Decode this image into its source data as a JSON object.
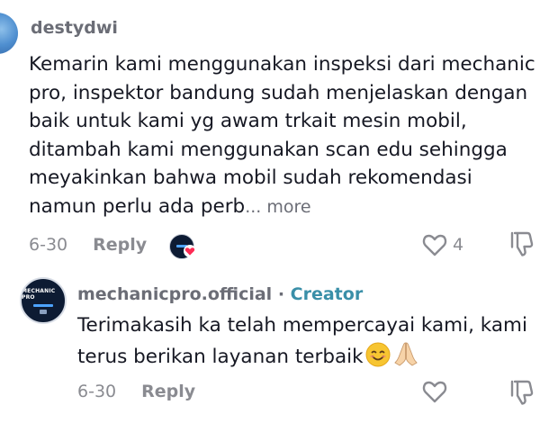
{
  "comments": [
    {
      "username": "destydwi",
      "text": "Kemarin kami menggunakan inspeksi dari mechanic pro, inspektor bandung sudah menjelaskan dengan baik untuk kami yg awam trkait mesin mobil, ditambah kami menggunakan scan edu sehingga meyakinkan bahwa mobil sudah rekomendasi namun perlu ada perb",
      "more_label": "... more",
      "date": "6-30",
      "reply_label": "Reply",
      "like_count": "4",
      "avatar_icon": "user-avatar",
      "liked_by_creator_icon": "creator-heart-badge"
    },
    {
      "username": "mechanicpro.official",
      "separator": " · ",
      "badge": "Creator",
      "text": "Terimakasih ka telah mempercayai kami, kami terus berikan layanan terbaik",
      "emojis": [
        "smiling-face-emoji",
        "folded-hands-emoji"
      ],
      "date": "6-30",
      "reply_label": "Reply",
      "avatar_logo_text": "MECHANIC PRO",
      "avatar_icon": "mechanicpro-logo"
    }
  ],
  "colors": {
    "text": "#161823",
    "muted": "#8a8b91",
    "creator": "#3a8fa8",
    "heart": "#fe2c55"
  }
}
